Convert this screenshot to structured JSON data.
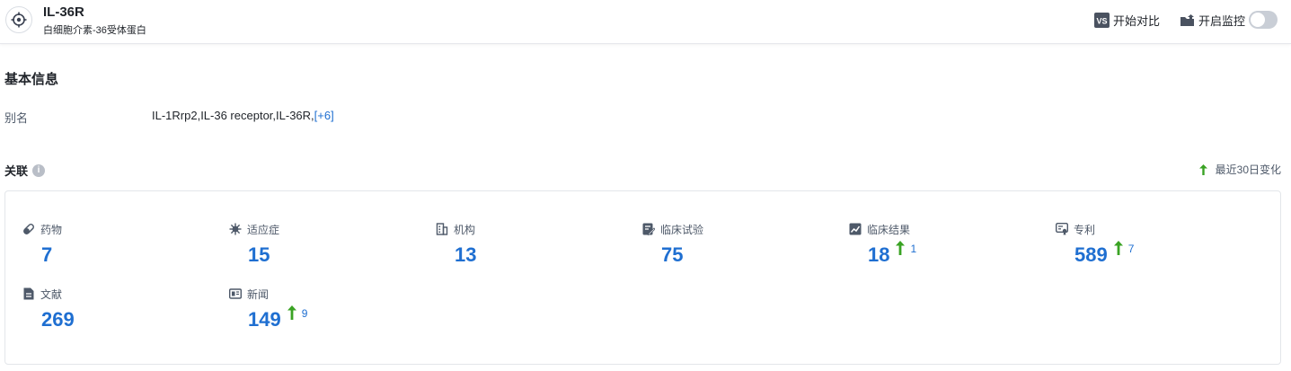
{
  "header": {
    "title": "IL-36R",
    "subtitle": "白细胞介素-36受体蛋白",
    "compare_label": "开始对比",
    "monitor_label": "开启监控",
    "monitor_on": false
  },
  "basic_info": {
    "section_title": "基本信息",
    "alias_label": "别名",
    "alias_value": "IL-1Rrp2,IL-36 receptor,IL-36R,",
    "alias_more": "[+6]"
  },
  "relations": {
    "title": "关联",
    "legend_label": "最近30日变化",
    "items": [
      {
        "label": "药物",
        "value": "7",
        "delta": "",
        "icon": "pill-icon"
      },
      {
        "label": "适应症",
        "value": "15",
        "delta": "",
        "icon": "virus-icon"
      },
      {
        "label": "机构",
        "value": "13",
        "delta": "",
        "icon": "building-icon"
      },
      {
        "label": "临床试验",
        "value": "75",
        "delta": "",
        "icon": "clinical-trial-icon"
      },
      {
        "label": "临床结果",
        "value": "18",
        "delta": "1",
        "icon": "clinical-result-icon"
      },
      {
        "label": "专利",
        "value": "589",
        "delta": "7",
        "icon": "patent-icon"
      },
      {
        "label": "文献",
        "value": "269",
        "delta": "",
        "icon": "document-icon"
      },
      {
        "label": "新闻",
        "value": "149",
        "delta": "9",
        "icon": "news-icon"
      }
    ]
  },
  "colors": {
    "accent": "#1f6fd1",
    "up_arrow": "#3aa324",
    "icon_dark": "#4e5969"
  }
}
